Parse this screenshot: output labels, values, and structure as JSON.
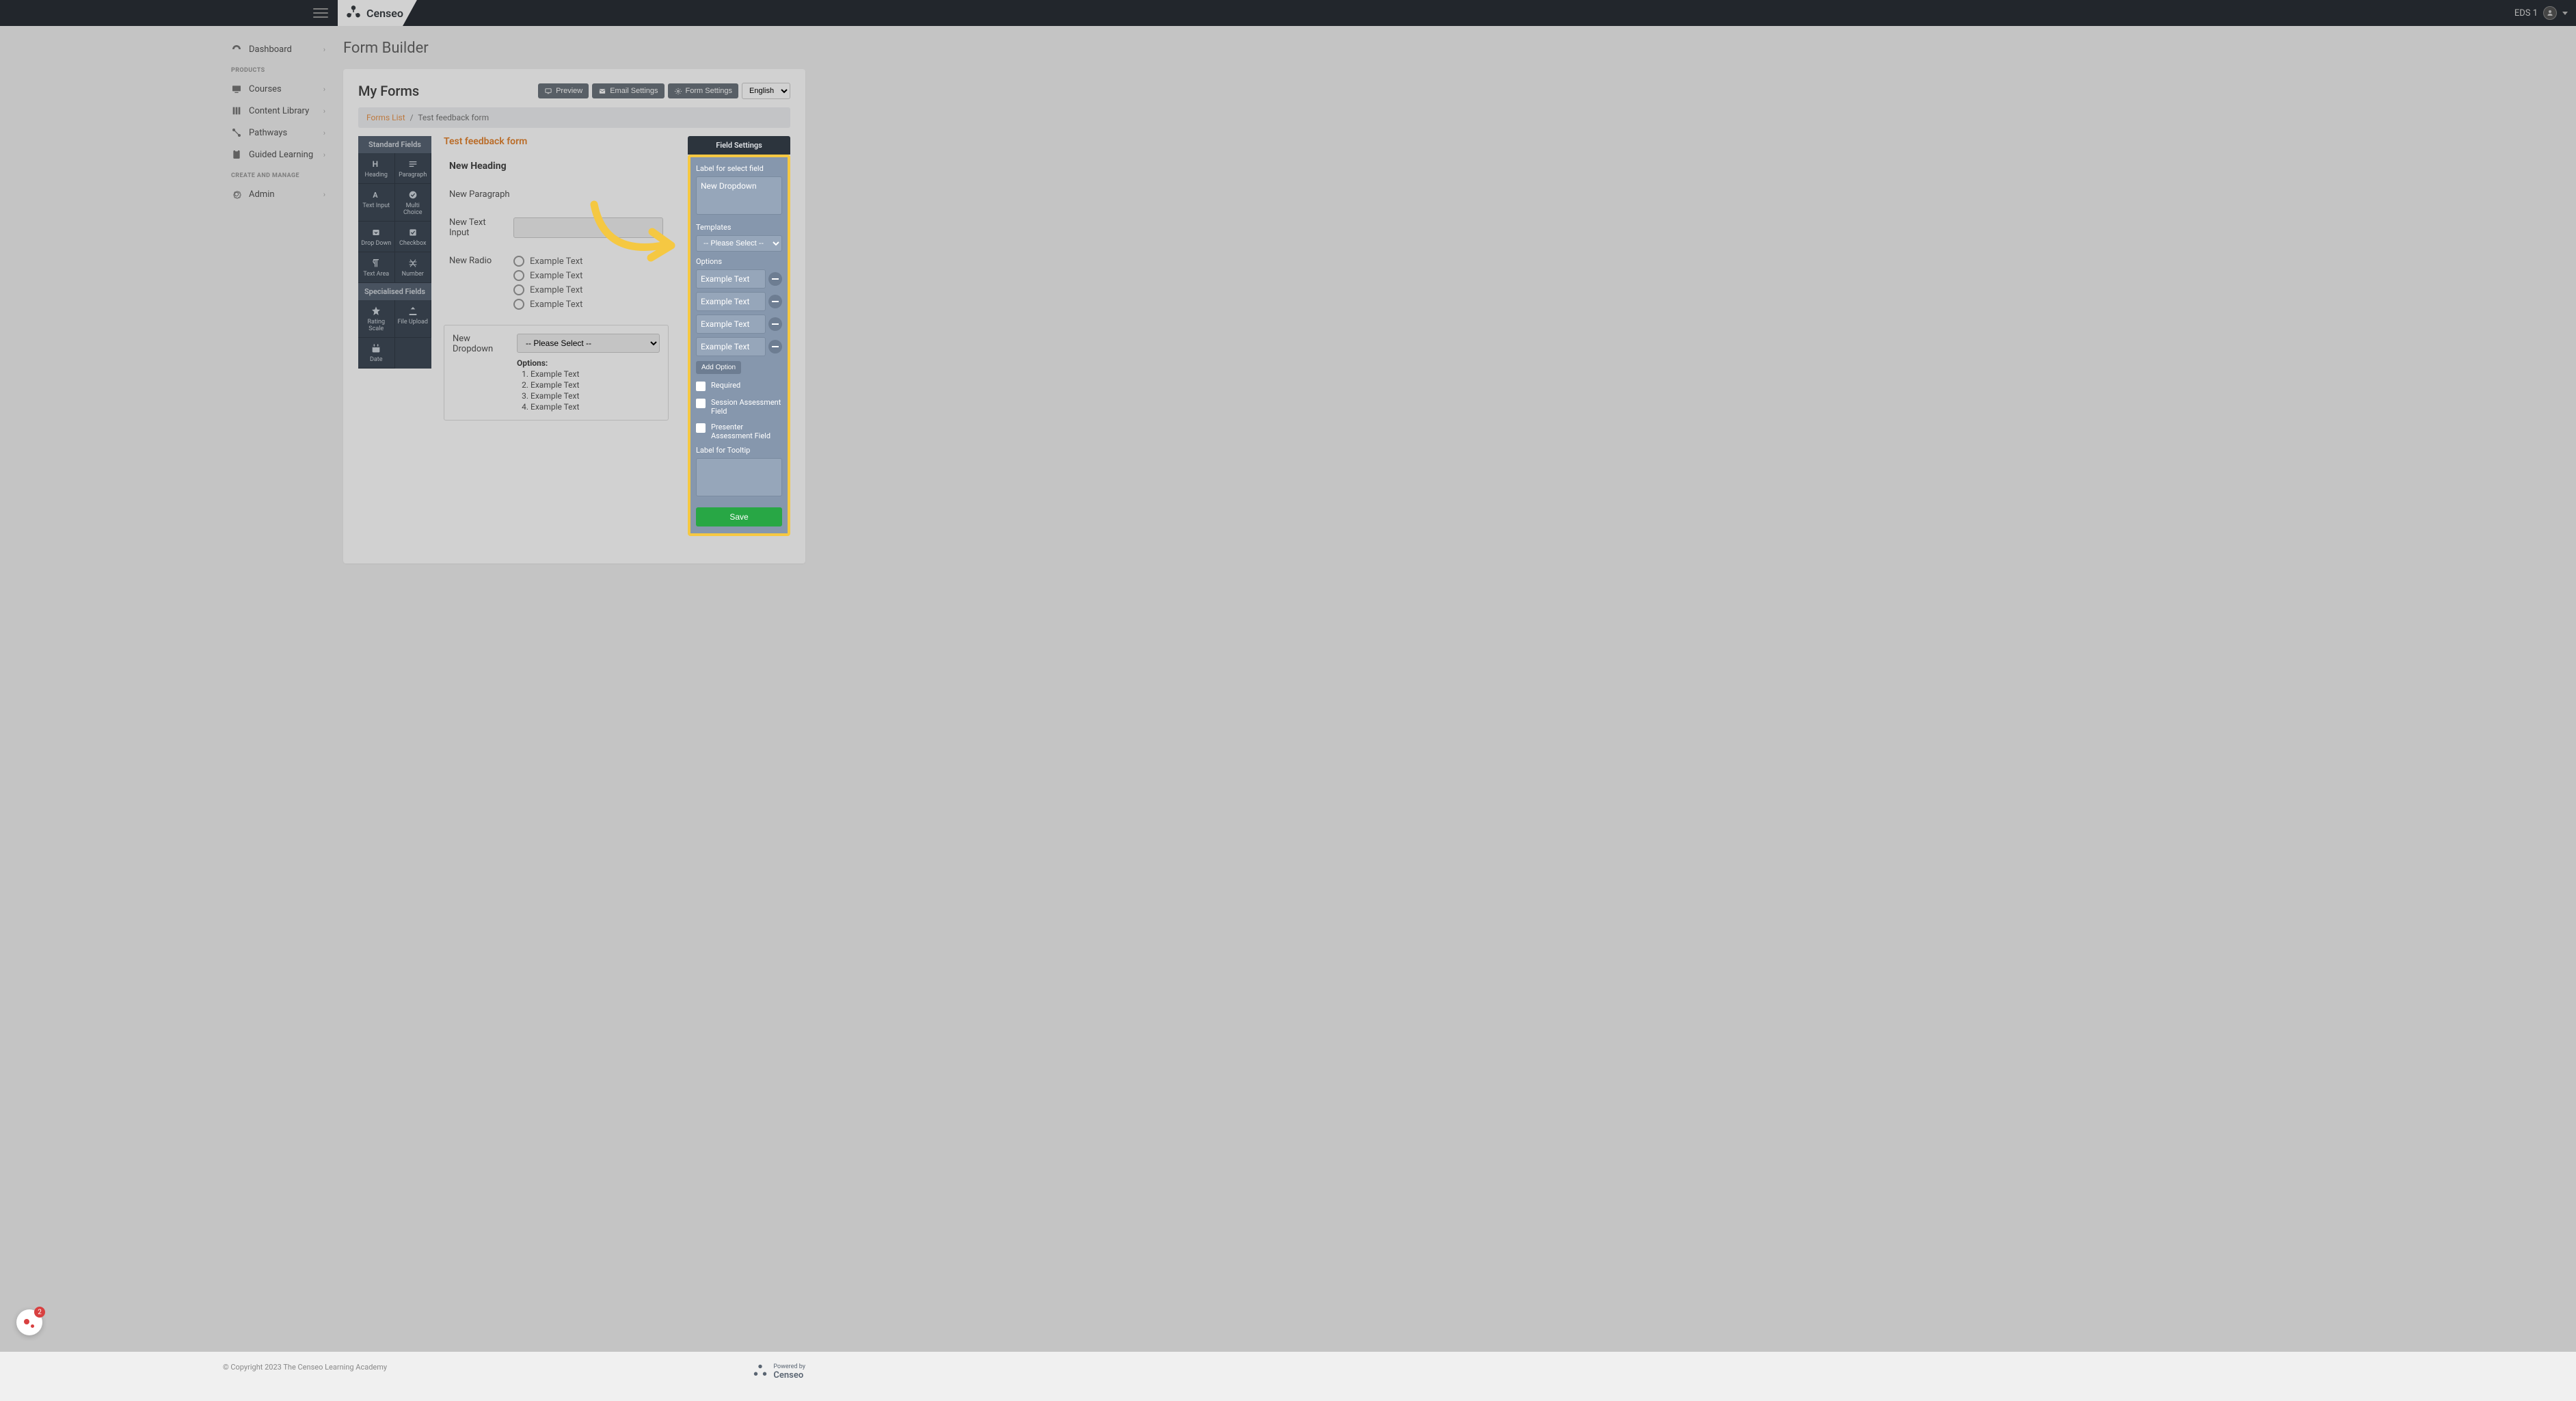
{
  "topbar": {
    "logo_text": "Censeo",
    "user_label": "EDS 1"
  },
  "sidebar": {
    "item_dashboard": "Dashboard",
    "section_products": "PRODUCTS",
    "item_courses": "Courses",
    "item_content_library": "Content Library",
    "item_pathways": "Pathways",
    "item_guided_learning": "Guided Learning",
    "section_create": "CREATE AND MANAGE",
    "item_admin": "Admin"
  },
  "page": {
    "title": "Form Builder",
    "card_title": "My Forms",
    "btn_preview": "Preview",
    "btn_email_settings": "Email Settings",
    "btn_form_settings": "Form Settings",
    "lang_selected": "English",
    "breadcrumb_link": "Forms List",
    "breadcrumb_current": "Test feedback form"
  },
  "palette": {
    "standard_header": "Standard Fields",
    "heading": "Heading",
    "paragraph": "Paragraph",
    "text_input": "Text Input",
    "multi_choice": "Multi Choice",
    "drop_down": "Drop Down",
    "checkbox": "Checkbox",
    "text_area": "Text Area",
    "number": "Number",
    "specialised_header": "Specialised Fields",
    "rating_scale": "Rating Scale",
    "file_upload": "File Upload",
    "date": "Date"
  },
  "canvas": {
    "form_title": "Test feedback form",
    "heading_label": "New Heading",
    "paragraph_label": "New Paragraph",
    "text_input_label": "New Text Input",
    "radio_label": "New Radio",
    "radio_opts": [
      "Example Text",
      "Example Text",
      "Example Text",
      "Example Text"
    ],
    "dropdown_label": "New Dropdown",
    "dropdown_placeholder": "-- Please Select --",
    "dropdown_options_title": "Options:",
    "dropdown_opts": [
      "Example Text",
      "Example Text",
      "Example Text",
      "Example Text"
    ]
  },
  "settings": {
    "tab": "Field Settings",
    "label_title": "Label for select field",
    "label_value": "New Dropdown",
    "templates_title": "Templates",
    "templates_placeholder": "-- Please Select --",
    "options_title": "Options",
    "opts": [
      "Example Text",
      "Example Text",
      "Example Text",
      "Example Text"
    ],
    "add_option": "Add Option",
    "chk_required": "Required",
    "chk_session": "Session Assessment Field",
    "chk_presenter": "Presenter Assessment Field",
    "tooltip_title": "Label for Tooltip",
    "save": "Save"
  },
  "footer": {
    "copyright": "© Copyright 2023 The Censeo Learning Academy",
    "powered_by": "Powered by",
    "powered_brand": "Censeo"
  },
  "help": {
    "badge": "2"
  }
}
